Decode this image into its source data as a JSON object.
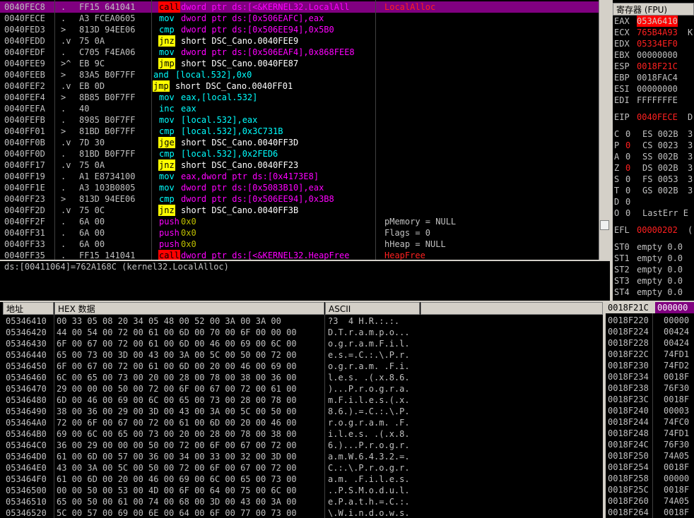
{
  "disasm": {
    "rows": [
      {
        "addr": "0040FEC8",
        "mark": ".",
        "bytes": "FF15 641041",
        "mn": "call",
        "cls": "m-call",
        "ops": "dword ptr ds:[<&KERNEL32.LocalAll",
        "comment": "LocalAlloc"
      },
      {
        "addr": "0040FECE",
        "mark": ".",
        "bytes": "A3 FCEA0605",
        "mn": "mov",
        "cls": "m-mov",
        "ops": "dword ptr ds:[0x506EAFC],eax",
        "comment": ""
      },
      {
        "addr": "0040FED3",
        "mark": ">",
        "bytes": "813D 94EE06",
        "mn": "cmp",
        "cls": "m-cmp",
        "ops": "dword ptr ds:[0x506EE94],0x5B0",
        "comment": ""
      },
      {
        "addr": "0040FEDD",
        "mark": ".v",
        "bytes": "75 0A",
        "mn": "jnz",
        "cls": "m-jcc",
        "ops": "short DSC_Cano.0040FEE9",
        "comment": ""
      },
      {
        "addr": "0040FEDF",
        "mark": ".",
        "bytes": "C705 F4EA06",
        "mn": "mov",
        "cls": "m-mov",
        "ops": "dword ptr ds:[0x506EAF4],0x868FEE8",
        "comment": ""
      },
      {
        "addr": "0040FEE9",
        "mark": ">^",
        "bytes": "EB 9C",
        "mn": "jmp",
        "cls": "m-jmp",
        "ops": "short DSC_Cano.0040FE87",
        "comment": ""
      },
      {
        "addr": "0040FEEB",
        "mark": ">",
        "bytes": "83A5 B0F7FF",
        "mn": "and",
        "cls": "m-and",
        "ops": "[local.532],0x0",
        "comment": ""
      },
      {
        "addr": "0040FEF2",
        "mark": ".v",
        "bytes": "EB 0D",
        "mn": "jmp",
        "cls": "m-jmp",
        "ops": "short DSC_Cano.0040FF01",
        "comment": ""
      },
      {
        "addr": "0040FEF4",
        "mark": ">",
        "bytes": "8B85 B0F7FF",
        "mn": "mov",
        "cls": "m-mov",
        "ops": "eax,[local.532]",
        "comment": ""
      },
      {
        "addr": "0040FEFA",
        "mark": ".",
        "bytes": "40",
        "mn": "inc",
        "cls": "m-inc",
        "ops": "eax",
        "comment": ""
      },
      {
        "addr": "0040FEFB",
        "mark": ".",
        "bytes": "8985 B0F7FF",
        "mn": "mov",
        "cls": "m-mov",
        "ops": "[local.532],eax",
        "comment": ""
      },
      {
        "addr": "0040FF01",
        "mark": ">",
        "bytes": "81BD B0F7FF",
        "mn": "cmp",
        "cls": "m-cmp",
        "ops": "[local.532],0x3C731B",
        "comment": ""
      },
      {
        "addr": "0040FF0B",
        "mark": ".v",
        "bytes": "7D 30",
        "mn": "jge",
        "cls": "m-jcc",
        "ops": "short DSC_Cano.0040FF3D",
        "comment": ""
      },
      {
        "addr": "0040FF0D",
        "mark": ".",
        "bytes": "81BD B0F7FF",
        "mn": "cmp",
        "cls": "m-cmp",
        "ops": "[local.532],0x2FED6",
        "comment": ""
      },
      {
        "addr": "0040FF17",
        "mark": ".v",
        "bytes": "75 0A",
        "mn": "jnz",
        "cls": "m-jcc",
        "ops": "short DSC_Cano.0040FF23",
        "comment": ""
      },
      {
        "addr": "0040FF19",
        "mark": ".",
        "bytes": "A1 E8734100",
        "mn": "mov",
        "cls": "m-mov",
        "ops": "eax,dword ptr ds:[0x4173E8]",
        "comment": ""
      },
      {
        "addr": "0040FF1E",
        "mark": ".",
        "bytes": "A3 103B0805",
        "mn": "mov",
        "cls": "m-mov",
        "ops": "dword ptr ds:[0x5083B10],eax",
        "comment": ""
      },
      {
        "addr": "0040FF23",
        "mark": ">",
        "bytes": "813D 94EE06",
        "mn": "cmp",
        "cls": "m-cmp",
        "ops": "dword ptr ds:[0x506EE94],0x3B8",
        "comment": ""
      },
      {
        "addr": "0040FF2D",
        "mark": ".v",
        "bytes": "75 0C",
        "mn": "jnz",
        "cls": "m-jcc",
        "ops": "short DSC_Cano.0040FF3B",
        "comment": ""
      },
      {
        "addr": "0040FF2F",
        "mark": ".",
        "bytes": "6A 00",
        "mn": "push",
        "cls": "m-push",
        "ops": "0x0",
        "comment": "pMemory = NULL"
      },
      {
        "addr": "0040FF31",
        "mark": ".",
        "bytes": "6A 00",
        "mn": "push",
        "cls": "m-push",
        "ops": "0x0",
        "comment": "Flags = 0"
      },
      {
        "addr": "0040FF33",
        "mark": ".",
        "bytes": "6A 00",
        "mn": "push",
        "cls": "m-push",
        "ops": "0x0",
        "comment": "hHeap = NULL"
      },
      {
        "addr": "0040FF35",
        "mark": ".",
        "bytes": "FF15 141041",
        "mn": "call",
        "cls": "m-call",
        "ops": "dword ptr ds:[<&KERNEL32.HeapFree",
        "comment": "HeapFree"
      }
    ],
    "info_line": "ds:[00411064]=762A168C (kernel32.LocalAlloc)"
  },
  "registers": {
    "title": "寄存器 (FPU)",
    "gp": [
      {
        "name": "EAX",
        "value": "053A6410",
        "extra": "",
        "hl": true
      },
      {
        "name": "ECX",
        "value": "765B4A93",
        "extra": "K",
        "red": true
      },
      {
        "name": "EDX",
        "value": "05334EF0",
        "extra": "",
        "red": true
      },
      {
        "name": "EBX",
        "value": "00000000",
        "extra": ""
      },
      {
        "name": "ESP",
        "value": "0018F21C",
        "extra": "",
        "red": true
      },
      {
        "name": "EBP",
        "value": "0018FAC4",
        "extra": ""
      },
      {
        "name": "ESI",
        "value": "00000000",
        "extra": ""
      },
      {
        "name": "EDI",
        "value": "FFFFFFFE",
        "extra": ""
      }
    ],
    "eip": {
      "name": "EIP",
      "value": "0040FECE",
      "extra": "D"
    },
    "flags": [
      {
        "f": "C",
        "v": "0",
        "seg": "ES 002B",
        "n": "3"
      },
      {
        "f": "P",
        "v": "0",
        "seg": "CS 0023",
        "n": "3",
        "red": true
      },
      {
        "f": "A",
        "v": "0",
        "seg": "SS 002B",
        "n": "3"
      },
      {
        "f": "Z",
        "v": "0",
        "seg": "DS 002B",
        "n": "3",
        "red": true
      },
      {
        "f": "S",
        "v": "0",
        "seg": "FS 0053",
        "n": "3"
      },
      {
        "f": "T",
        "v": "0",
        "seg": "GS 002B",
        "n": "3"
      },
      {
        "f": "D",
        "v": "0",
        "seg": "",
        "n": ""
      },
      {
        "f": "O",
        "v": "0",
        "seg": "LastErr E",
        "n": ""
      }
    ],
    "efl": {
      "name": "EFL",
      "value": "00000202",
      "extra": "("
    },
    "fpu": [
      {
        "name": "ST0",
        "value": "empty 0.0"
      },
      {
        "name": "ST1",
        "value": "empty 0.0"
      },
      {
        "name": "ST2",
        "value": "empty 0.0"
      },
      {
        "name": "ST3",
        "value": "empty 0.0"
      },
      {
        "name": "ST4",
        "value": "empty 0.0"
      }
    ]
  },
  "dump": {
    "col_addr": "地址",
    "col_hex": "HEX 数据",
    "col_ascii": "ASCII",
    "rows": [
      {
        "addr": "05346410",
        "hex": "00 33 05 08 20 34 05 48 00 52 00 3A 00 3A 00",
        "ascii": "?3  4 H.R.:.:."
      },
      {
        "addr": "05346420",
        "hex": "44 00 54 00 72 00 61 00 6D 00 70 00 6F 00 00 00",
        "ascii": "D.T.r.a.m.p.o..."
      },
      {
        "addr": "05346430",
        "hex": "6F 00 67 00 72 00 61 00 6D 00 46 00 69 00 6C 00",
        "ascii": "o.g.r.a.m.F.i.l."
      },
      {
        "addr": "05346440",
        "hex": "65 00 73 00 3D 00 43 00 3A 00 5C 00 50 00 72 00",
        "ascii": "e.s.=.C.:.\\.P.r."
      },
      {
        "addr": "05346450",
        "hex": "6F 00 67 00 72 00 61 00 6D 00 20 00 46 00 69 00",
        "ascii": "o.g.r.a.m. .F.i."
      },
      {
        "addr": "05346460",
        "hex": "6C 00 65 00 73 00 20 00 28 00 78 00 38 00 36 00",
        "ascii": "l.e.s. .(.x.8.6."
      },
      {
        "addr": "05346470",
        "hex": "29 00 00 00 50 00 72 00 6F 00 67 00 72 00 61 00",
        "ascii": ")...P.r.o.g.r.a."
      },
      {
        "addr": "05346480",
        "hex": "6D 00 46 00 69 00 6C 00 65 00 73 00 28 00 78 00",
        "ascii": "m.F.i.l.e.s.(.x."
      },
      {
        "addr": "05346490",
        "hex": "38 00 36 00 29 00 3D 00 43 00 3A 00 5C 00 50 00",
        "ascii": "8.6.).=.C.:.\\.P."
      },
      {
        "addr": "053464A0",
        "hex": "72 00 6F 00 67 00 72 00 61 00 6D 00 20 00 46 00",
        "ascii": "r.o.g.r.a.m. .F."
      },
      {
        "addr": "053464B0",
        "hex": "69 00 6C 00 65 00 73 00 20 00 28 00 78 00 38 00",
        "ascii": "i.l.e.s. .(.x.8."
      },
      {
        "addr": "053464C0",
        "hex": "36 00 29 00 00 00 50 00 72 00 6F 00 67 00 72 00",
        "ascii": "6.)...P.r.o.g.r."
      },
      {
        "addr": "053464D0",
        "hex": "61 00 6D 00 57 00 36 00 34 00 33 00 32 00 3D 00",
        "ascii": "a.m.W.6.4.3.2.=."
      },
      {
        "addr": "053464E0",
        "hex": "43 00 3A 00 5C 00 50 00 72 00 6F 00 67 00 72 00",
        "ascii": "C.:.\\.P.r.o.g.r."
      },
      {
        "addr": "053464F0",
        "hex": "61 00 6D 00 20 00 46 00 69 00 6C 00 65 00 73 00",
        "ascii": "a.m. .F.i.l.e.s."
      },
      {
        "addr": "05346500",
        "hex": "00 00 50 00 53 00 4D 00 6F 00 64 00 75 00 6C 00",
        "ascii": "..P.S.M.o.d.u.l."
      },
      {
        "addr": "05346510",
        "hex": "65 00 50 00 61 00 74 00 68 00 3D 00 43 00 3A 00",
        "ascii": "e.P.a.t.h.=.C.:."
      },
      {
        "addr": "05346520",
        "hex": "5C 00 57 00 69 00 6E 00 64 00 6F 00 77 00 73 00",
        "ascii": "\\.W.i.n.d.o.w.s."
      }
    ]
  },
  "stack": {
    "top_addr": "0018F21C",
    "top_val": "000000",
    "rows": [
      {
        "addr": "0018F220",
        "val": "00000"
      },
      {
        "addr": "0018F224",
        "val": "00424"
      },
      {
        "addr": "0018F228",
        "val": "00424"
      },
      {
        "addr": "0018F22C",
        "val": "74FD1"
      },
      {
        "addr": "0018F230",
        "val": "74FD2"
      },
      {
        "addr": "0018F234",
        "val": "0018F"
      },
      {
        "addr": "0018F238",
        "val": "76F30"
      },
      {
        "addr": "0018F23C",
        "val": "0018F"
      },
      {
        "addr": "0018F240",
        "val": "00003"
      },
      {
        "addr": "0018F244",
        "val": "74FC0"
      },
      {
        "addr": "0018F248",
        "val": "74FD1"
      },
      {
        "addr": "0018F24C",
        "val": "76F30"
      },
      {
        "addr": "0018F250",
        "val": "74A05"
      },
      {
        "addr": "0018F254",
        "val": "0018F"
      },
      {
        "addr": "0018F258",
        "val": "00000"
      },
      {
        "addr": "0018F25C",
        "val": "0018F"
      },
      {
        "addr": "0018F260",
        "val": "74A05"
      },
      {
        "addr": "0018F264",
        "val": "0018F"
      }
    ]
  }
}
